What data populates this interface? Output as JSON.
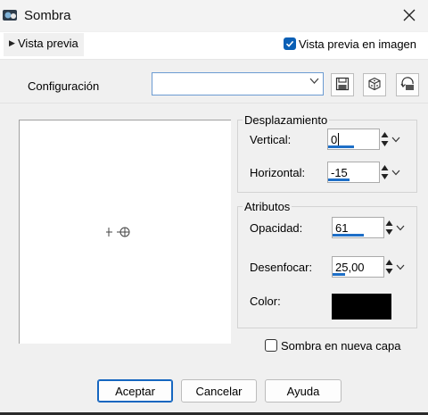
{
  "window": {
    "title": "Sombra",
    "icons": {
      "app": "paint-app-icon",
      "close": "close-icon"
    }
  },
  "preview_bar": {
    "toggle_label": "Vista previa",
    "checkbox_label": "Vista previa en imagen",
    "checkbox_checked": true
  },
  "config": {
    "label": "Configuración",
    "value": "",
    "buttons": [
      "save-icon",
      "random-dice-icon",
      "reset-icon"
    ]
  },
  "displacement": {
    "title": "Desplazamiento",
    "vertical": {
      "label": "Vertical:",
      "value": "0",
      "level": 0.5
    },
    "horizontal": {
      "label": "Horizontal:",
      "value": "-15",
      "level": 0.42
    }
  },
  "attributes": {
    "title": "Atributos",
    "opacity": {
      "label": "Opacidad:",
      "value": "61",
      "level": 0.61
    },
    "blur": {
      "label": "Desenfocar:",
      "value": "25,00",
      "level": 0.25
    },
    "color": {
      "label": "Color:",
      "value": "#000000"
    }
  },
  "new_layer": {
    "label": "Sombra en nueva capa",
    "checked": false
  },
  "buttons": {
    "ok": "Aceptar",
    "cancel": "Cancelar",
    "help": "Ayuda"
  },
  "colors": {
    "accent": "#0a5fb5",
    "swatch": "#000000"
  }
}
